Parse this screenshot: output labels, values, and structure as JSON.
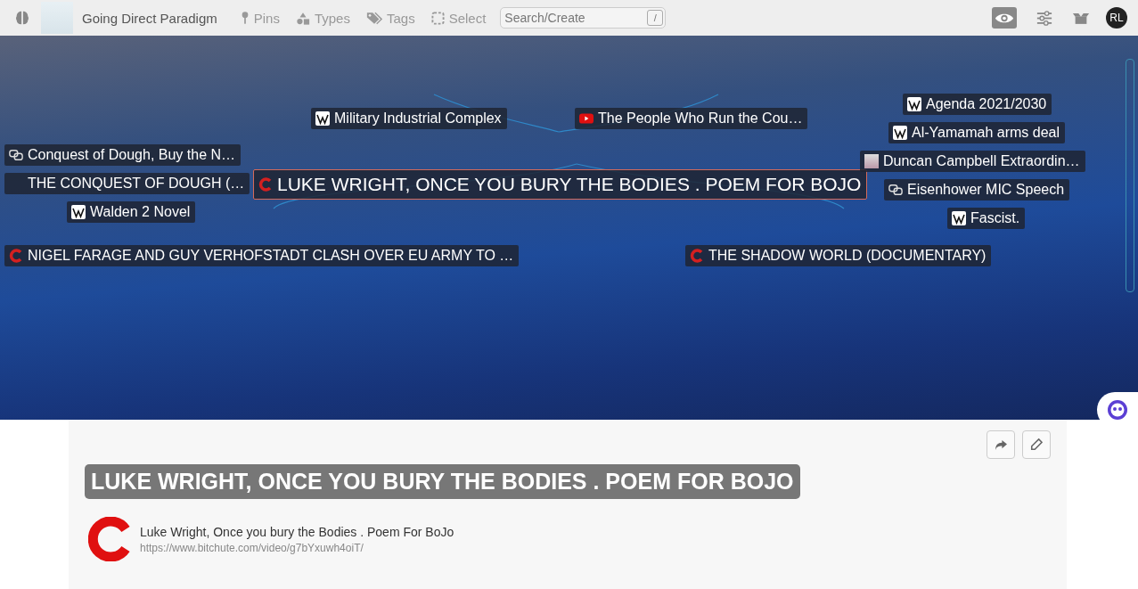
{
  "toolbar": {
    "graph_title": "Going Direct Paradigm",
    "tools": [
      {
        "kind": "pins",
        "label": "Pins"
      },
      {
        "kind": "types",
        "label": "Types"
      },
      {
        "kind": "tags",
        "label": "Tags"
      },
      {
        "kind": "select",
        "label": "Select"
      }
    ],
    "search": {
      "placeholder": "Search/Create",
      "shortcut": "/"
    },
    "eye_on": true,
    "avatar": "RL"
  },
  "nodes": [
    {
      "label": "Military Industrial Complex",
      "kind": "wiki",
      "selected": false
    },
    {
      "label": "The People Who Run the Cou…",
      "kind": "youtube",
      "selected": false
    },
    {
      "label": "Agenda 2021/2030",
      "kind": "wiki",
      "selected": false
    },
    {
      "label": "Al-Yamamah arms deal",
      "kind": "wiki",
      "selected": false
    },
    {
      "label": "Conquest of Dough, Buy the N…",
      "kind": "link",
      "selected": false
    },
    {
      "label": "THE CONQUEST OF DOUGH (…",
      "kind": "none",
      "selected": false
    },
    {
      "label": "LUKE WRIGHT, ONCE YOU BURY THE BODIES . POEM FOR BOJO",
      "kind": "bitchute",
      "selected": true
    },
    {
      "label": "Duncan Campbell Extraordin…",
      "kind": "image",
      "selected": false
    },
    {
      "label": "Eisenhower MIC Speech",
      "kind": "link",
      "selected": false
    },
    {
      "label": "Walden 2 Novel",
      "kind": "wiki",
      "selected": false
    },
    {
      "label": "Fascist.",
      "kind": "wiki",
      "selected": false
    },
    {
      "label": "NIGEL FARAGE AND GUY VERHOFSTADT CLASH OVER EU ARMY TO …",
      "kind": "bitchute",
      "selected": false
    },
    {
      "label": "THE SHADOW WORLD (DOCUMENTARY)",
      "kind": "bitchute",
      "selected": false
    }
  ],
  "detail": {
    "title": "LUKE WRIGHT, ONCE YOU BURY THE BODIES . POEM FOR BOJO",
    "link": {
      "title": "Luke Wright, Once you bury the Bodies . Poem For BoJo",
      "url": "https://www.bitchute.com/video/g7bYxuwh4oiT/"
    }
  }
}
